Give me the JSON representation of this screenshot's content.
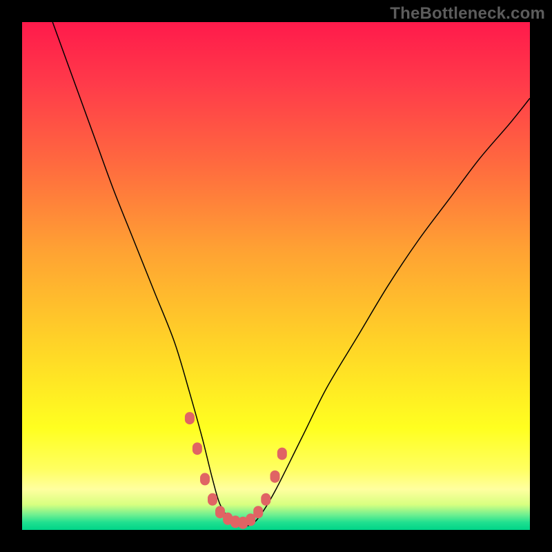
{
  "watermark": "TheBottleneck.com",
  "colors": {
    "page_bg": "#000000",
    "curve_stroke": "#000000",
    "marker_fill": "#e06464",
    "gradient_top": "#ff1a4b",
    "gradient_bottom": "#00d488"
  },
  "chart_data": {
    "type": "line",
    "title": "",
    "xlabel": "",
    "ylabel": "",
    "xlim": [
      0,
      100
    ],
    "ylim": [
      0,
      100
    ],
    "grid": false,
    "legend": false,
    "note": "V-shaped bottleneck curve; x is relative horizontal position (0–100 left→right), y is relative height (0 at bottom, 100 at top). Values estimated from pixels.",
    "series": [
      {
        "name": "curve",
        "x": [
          6,
          10,
          14,
          18,
          22,
          26,
          30,
          33,
          35.5,
          37.5,
          39,
          41,
          43,
          45,
          47,
          50,
          55,
          60,
          66,
          72,
          78,
          84,
          90,
          96,
          100
        ],
        "y": [
          100,
          89,
          78,
          67,
          57,
          47,
          37,
          27,
          18,
          10,
          5,
          2,
          1,
          1,
          3,
          8,
          18,
          28,
          38,
          48,
          57,
          65,
          73,
          80,
          85
        ]
      }
    ],
    "markers": {
      "note": "Pink rounded dots near trough of curve",
      "points": [
        {
          "x": 33.0,
          "y": 22
        },
        {
          "x": 34.5,
          "y": 16
        },
        {
          "x": 36.0,
          "y": 10
        },
        {
          "x": 37.5,
          "y": 6
        },
        {
          "x": 39.0,
          "y": 3.5
        },
        {
          "x": 40.5,
          "y": 2.2
        },
        {
          "x": 42.0,
          "y": 1.6
        },
        {
          "x": 43.5,
          "y": 1.4
        },
        {
          "x": 45.0,
          "y": 2.0
        },
        {
          "x": 46.5,
          "y": 3.5
        },
        {
          "x": 48.0,
          "y": 6.0
        },
        {
          "x": 49.8,
          "y": 10.5
        },
        {
          "x": 51.2,
          "y": 15.0
        }
      ]
    }
  }
}
